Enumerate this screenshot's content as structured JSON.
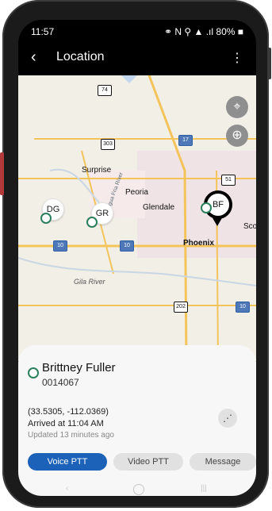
{
  "status": {
    "time": "11:57",
    "right": "⚭ N ⚲ ▲ .ıl 80% ■"
  },
  "appbar": {
    "back_glyph": "‹",
    "title": "Location",
    "more_glyph": "⋮"
  },
  "map": {
    "controls": {
      "locate_glyph": "⌖",
      "center_glyph": "⊕"
    },
    "labels": {
      "surprise": "Surprise",
      "peoria": "Peoria",
      "glendale": "Glendale",
      "phoenix": "Phoenix",
      "scot": "Scot",
      "gila_river": "Gila River",
      "agua_fria_river": "Agua Fria River"
    },
    "routes": [
      "74",
      "303",
      "17",
      "51",
      "10",
      "10",
      "202",
      "10"
    ],
    "markers": {
      "dg": "DG",
      "gr": "GR",
      "bf": "BF"
    }
  },
  "sheet": {
    "name": "Brittney Fuller",
    "id": "0014067",
    "coords": "(33.5305, -112.0369)",
    "arrived": "Arrived at 11:04 AM",
    "updated": "Updated 13 minutes ago",
    "share_glyph": "⋰",
    "buttons": {
      "voice": "Voice PTT",
      "video": "Video PTT",
      "message": "Message"
    }
  },
  "nav": {
    "back": "‹",
    "recent": "|||"
  },
  "colors": {
    "primary_button": "#1b62b8",
    "user_icon": "#2b7f5c",
    "map_bg": "#f2efe7"
  }
}
